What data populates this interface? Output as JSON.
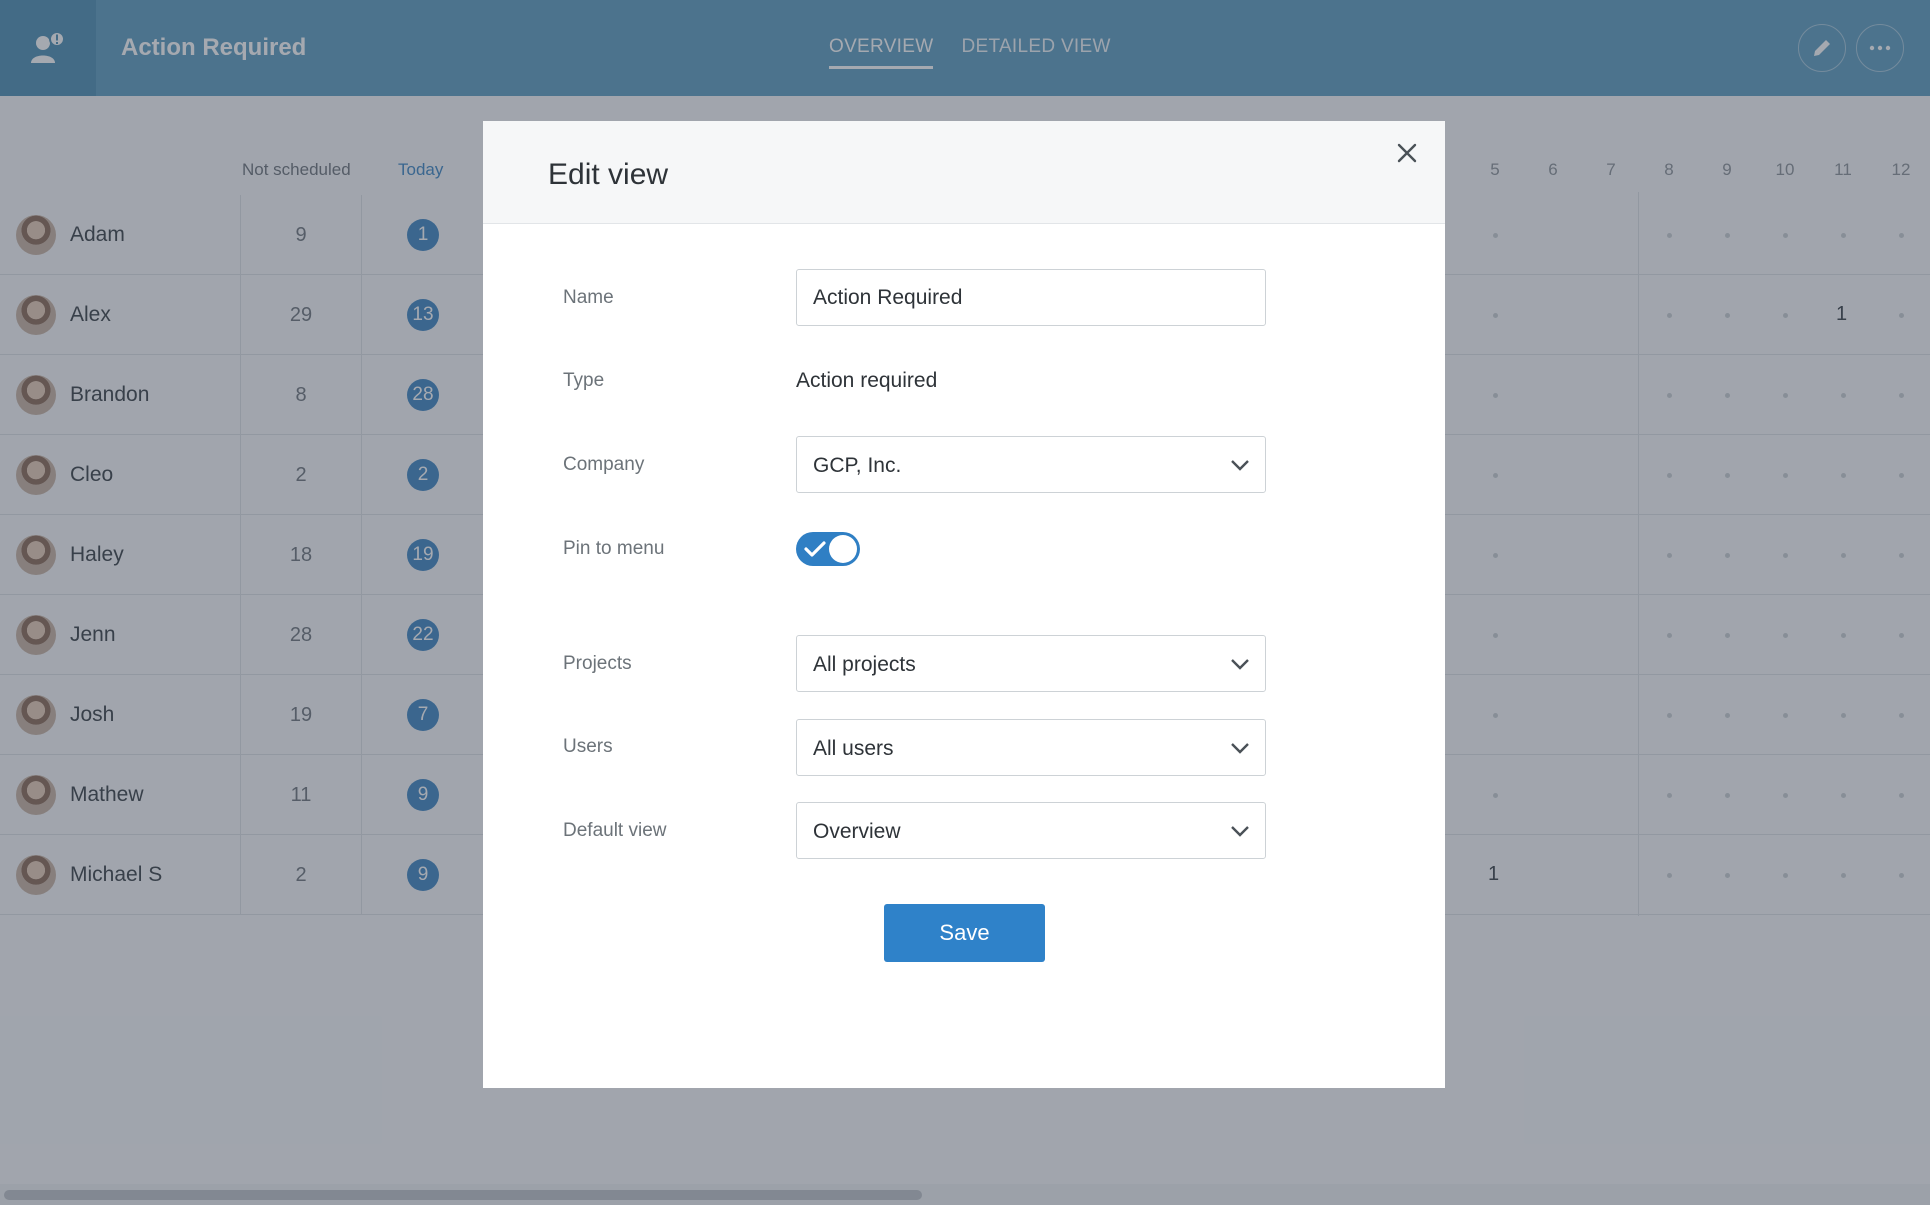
{
  "header": {
    "title": "Action Required",
    "tabs": [
      {
        "label": "OVERVIEW",
        "active": true
      },
      {
        "label": "DETAILED VIEW",
        "active": false
      }
    ],
    "actions": [
      {
        "icon": "pencil-icon"
      },
      {
        "icon": "more-horizontal-icon",
        "label": "···"
      }
    ],
    "accent_color": "#5d9dbf"
  },
  "grid": {
    "columns": {
      "not_scheduled": "Not scheduled",
      "today": "Today",
      "days": [
        "5",
        "6",
        "7",
        "8",
        "9",
        "10",
        "11",
        "12"
      ]
    },
    "rows": [
      {
        "name": "Adam",
        "not_scheduled": "9",
        "today": "1"
      },
      {
        "name": "Alex",
        "not_scheduled": "29",
        "today": "13",
        "day_11": "1"
      },
      {
        "name": "Brandon",
        "not_scheduled": "8",
        "today": "28"
      },
      {
        "name": "Cleo",
        "not_scheduled": "2",
        "today": "2"
      },
      {
        "name": "Haley",
        "not_scheduled": "18",
        "today": "19"
      },
      {
        "name": "Jenn",
        "not_scheduled": "28",
        "today": "22"
      },
      {
        "name": "Josh",
        "not_scheduled": "19",
        "today": "7"
      },
      {
        "name": "Mathew",
        "not_scheduled": "11",
        "today": "9"
      },
      {
        "name": "Michael S",
        "not_scheduled": "2",
        "today": "9",
        "day_5": "1"
      }
    ]
  },
  "modal": {
    "title": "Edit view",
    "fields": {
      "name": {
        "label": "Name",
        "value": "Action Required"
      },
      "type": {
        "label": "Type",
        "value": "Action required"
      },
      "company": {
        "label": "Company",
        "value": "GCP, Inc."
      },
      "pin": {
        "label": "Pin to menu",
        "checked": true
      },
      "projects": {
        "label": "Projects",
        "value": "All projects"
      },
      "users": {
        "label": "Users",
        "value": "All users"
      },
      "default_view": {
        "label": "Default view",
        "value": "Overview"
      }
    },
    "save_label": "Save",
    "primary_color": "#2f82c9"
  }
}
